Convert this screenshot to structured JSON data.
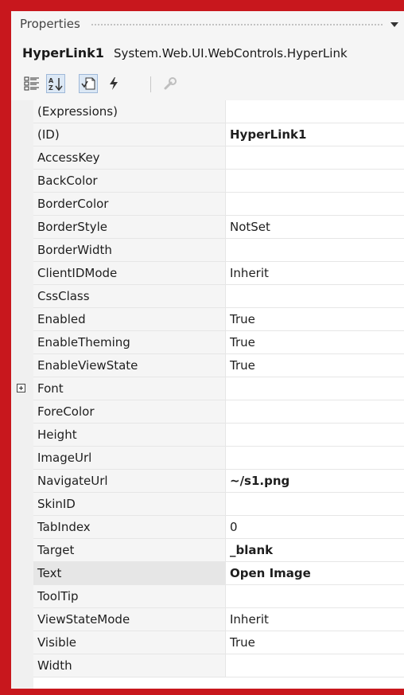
{
  "titlebar": {
    "title": "Properties"
  },
  "object": {
    "name": "HyperLink1",
    "type": "System.Web.UI.WebControls.HyperLink"
  },
  "toolbar": {
    "buttons": [
      {
        "icon": "categorized-icon"
      },
      {
        "icon": "alphabetical-icon",
        "pressed": true
      },
      {
        "icon": "properties-icon",
        "pressed": true
      },
      {
        "icon": "events-icon"
      },
      {
        "icon": "property-pages-icon",
        "disabled": true
      }
    ]
  },
  "properties": [
    {
      "name": "(Expressions)",
      "value": ""
    },
    {
      "name": "(ID)",
      "value": "HyperLink1",
      "bold": true
    },
    {
      "name": "AccessKey",
      "value": ""
    },
    {
      "name": "BackColor",
      "value": ""
    },
    {
      "name": "BorderColor",
      "value": ""
    },
    {
      "name": "BorderStyle",
      "value": "NotSet"
    },
    {
      "name": "BorderWidth",
      "value": ""
    },
    {
      "name": "ClientIDMode",
      "value": "Inherit"
    },
    {
      "name": "CssClass",
      "value": ""
    },
    {
      "name": "Enabled",
      "value": "True"
    },
    {
      "name": "EnableTheming",
      "value": "True"
    },
    {
      "name": "EnableViewState",
      "value": "True"
    },
    {
      "name": "Font",
      "value": "",
      "expandable": true
    },
    {
      "name": "ForeColor",
      "value": ""
    },
    {
      "name": "Height",
      "value": ""
    },
    {
      "name": "ImageUrl",
      "value": ""
    },
    {
      "name": "NavigateUrl",
      "value": "~/s1.png",
      "bold": true
    },
    {
      "name": "SkinID",
      "value": ""
    },
    {
      "name": "TabIndex",
      "value": "0"
    },
    {
      "name": "Target",
      "value": "_blank",
      "bold": true
    },
    {
      "name": "Text",
      "value": "Open Image",
      "bold": true,
      "selected": true
    },
    {
      "name": "ToolTip",
      "value": ""
    },
    {
      "name": "ViewStateMode",
      "value": "Inherit"
    },
    {
      "name": "Visible",
      "value": "True"
    },
    {
      "name": "Width",
      "value": ""
    }
  ],
  "colors": {
    "frame": "#c8171d",
    "panel": "#f5f5f5",
    "grid_line": "#e6e6e6"
  }
}
